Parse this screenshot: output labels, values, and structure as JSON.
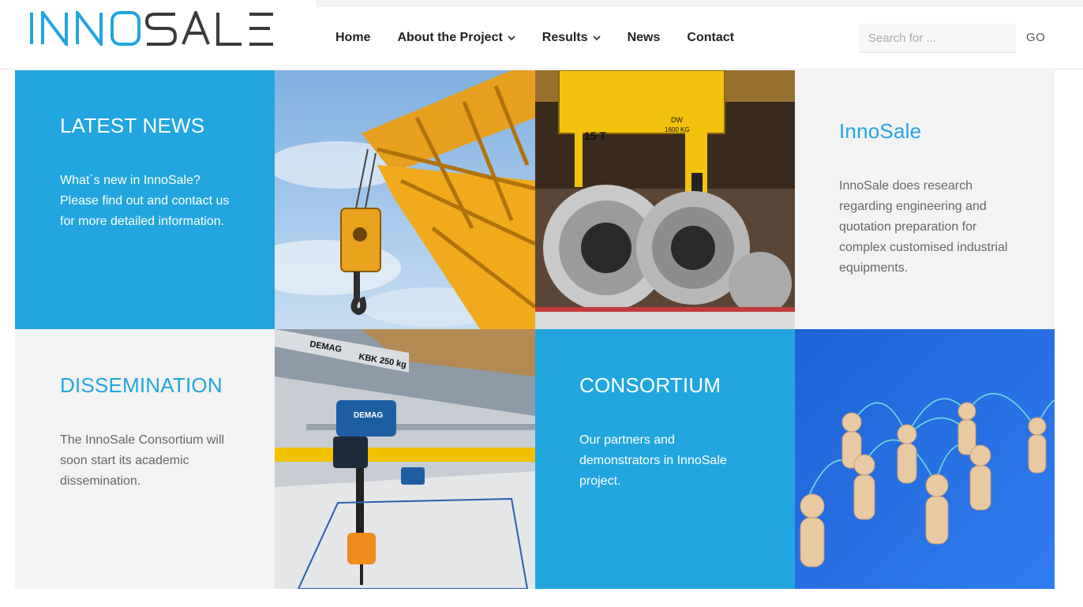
{
  "brand": {
    "logo_text_a": "INNO",
    "logo_text_b": "SALE"
  },
  "nav": {
    "items": [
      {
        "label": "Home",
        "dropdown": false
      },
      {
        "label": "About the Project",
        "dropdown": true
      },
      {
        "label": "Results",
        "dropdown": true
      },
      {
        "label": "News",
        "dropdown": false
      },
      {
        "label": "Contact",
        "dropdown": false
      }
    ]
  },
  "search": {
    "placeholder": "Search for ...",
    "go_label": "GO"
  },
  "tiles": {
    "latest_news": {
      "title": "LATEST NEWS",
      "text": "What´s new in InnoSale? Please find out and contact us for more detailed information."
    },
    "innosale": {
      "title": "InnoSale",
      "text": "InnoSale does research regarding engineering and quotation preparation for complex customised industrial equipments."
    },
    "dissemination": {
      "title": "DISSEMINATION",
      "text": "The InnoSale Consortium will soon start its academic dissemination."
    },
    "consortium": {
      "title": "CONSORTIUM",
      "text": "Our partners and demonstrators in InnoSale project."
    }
  },
  "images": {
    "hoist_sign_1": "15 T",
    "hoist_sign_2": "DW",
    "hoist_sign_3": "1600 KG",
    "crane_brand": "DEMAG",
    "crane_label": "KBK 250 kg",
    "hoist_brand": "DEMAG"
  },
  "colors": {
    "accent": "#22a6df",
    "logo_dark": "#3a3a3a",
    "logo_blue": "#22a6df",
    "grey_tile": "#f3f3f3"
  }
}
